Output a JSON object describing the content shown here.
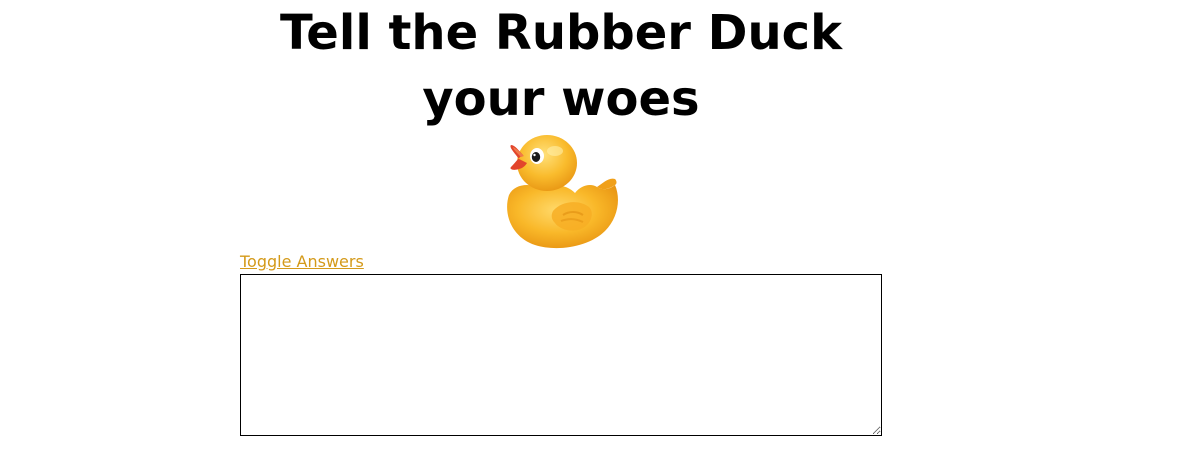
{
  "header": {
    "title": "Tell the Rubber Duck your woes"
  },
  "duck": {
    "icon": "rubber-duck-icon",
    "body_color": "#f7b21e",
    "beak_color": "#e2452c"
  },
  "controls": {
    "toggle_label": "Toggle Answers",
    "link_color": "#d49a1a"
  },
  "input": {
    "value": "",
    "placeholder": ""
  }
}
